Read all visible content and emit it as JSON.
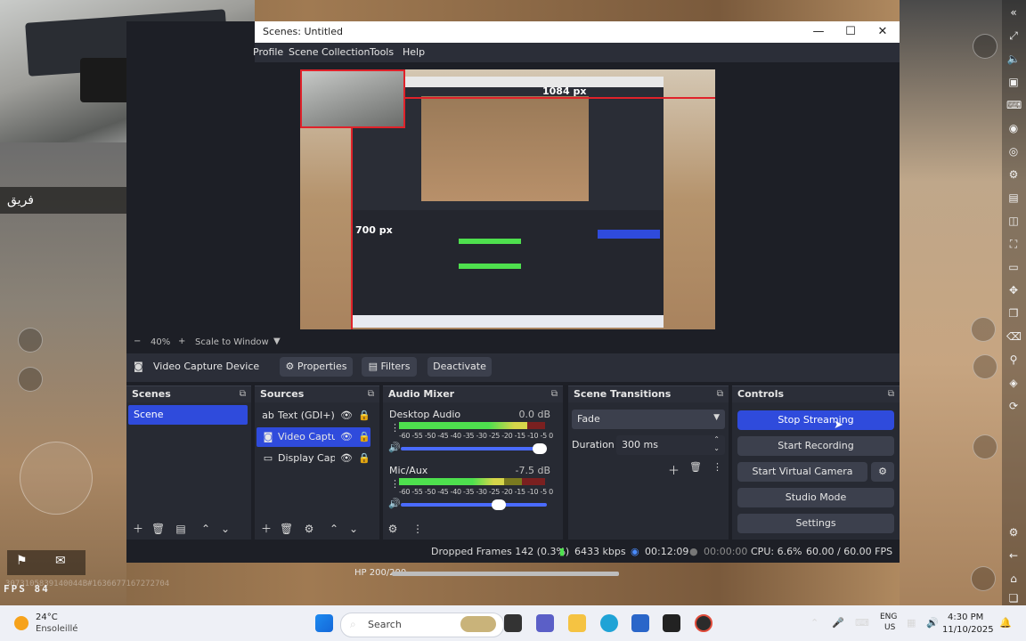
{
  "game": {
    "squad_label": "فريق",
    "fps_text": "FPS  84",
    "serial_text": "3073105839140044B#1636677167272704",
    "hp_text": "HP 200/200",
    "hp_fraction": 1.0
  },
  "obs": {
    "window_title": "Scenes: Untitled",
    "menu": [
      "Profile",
      "Scene Collection",
      "Tools",
      "Help"
    ],
    "preview": {
      "dim_width": "1084 px",
      "dim_height": "700 px"
    },
    "zoom": {
      "percent": "40%",
      "scale_label": "Scale to Window"
    },
    "source_toolbar": {
      "source_name": "Video Capture Device",
      "properties_label": "Properties",
      "filters_label": "Filters",
      "deactivate_label": "Deactivate"
    },
    "docks": {
      "scenes": {
        "title": "Scenes",
        "items": [
          "Scene"
        ]
      },
      "sources": {
        "title": "Sources",
        "items": [
          {
            "icon": "text-icon",
            "name": "Text (GDI+)",
            "selected": false
          },
          {
            "icon": "camera-icon",
            "name": "Video Capture Device",
            "selected": true
          },
          {
            "icon": "monitor-icon",
            "name": "Display Capture",
            "selected": false
          }
        ]
      },
      "audio_mixer": {
        "title": "Audio Mixer",
        "channels": [
          {
            "name": "Desktop Audio",
            "db": "0.0 dB",
            "level": 0.88,
            "volume": 1.0
          },
          {
            "name": "Mic/Aux",
            "db": "-7.5 dB",
            "level": 0.72,
            "volume": 0.72
          }
        ],
        "scale": "-60 -55 -50 -45 -40 -35 -30 -25 -20 -15 -10 -5  0"
      },
      "transitions": {
        "title": "Scene Transitions",
        "selected": "Fade",
        "duration_label": "Duration",
        "duration_value": "300 ms"
      },
      "controls": {
        "title": "Controls",
        "stop_streaming": "Stop Streaming",
        "start_recording": "Start Recording",
        "start_virtual_camera": "Start Virtual Camera",
        "studio_mode": "Studio Mode",
        "settings": "Settings"
      }
    },
    "status": {
      "dropped_frames": "Dropped Frames 142 (0.3%)",
      "bitrate": "6433 kbps",
      "stream_time": "00:12:09",
      "record_time": "00:00:00",
      "cpu": "CPU: 6.6%",
      "fps": "60.00 / 60.00 FPS"
    }
  },
  "taskbar": {
    "weather_temp": "24°C",
    "weather_desc": "Ensoleillé",
    "search_placeholder": "Search",
    "lang": "ENG",
    "region": "US",
    "time": "4:30 PM",
    "date": "11/10/2025"
  },
  "colors": {
    "accent": "#2f4bdc",
    "obs_bg": "#1d1f26",
    "dock_bg": "#272a33",
    "selection_red": "#e0222a"
  }
}
